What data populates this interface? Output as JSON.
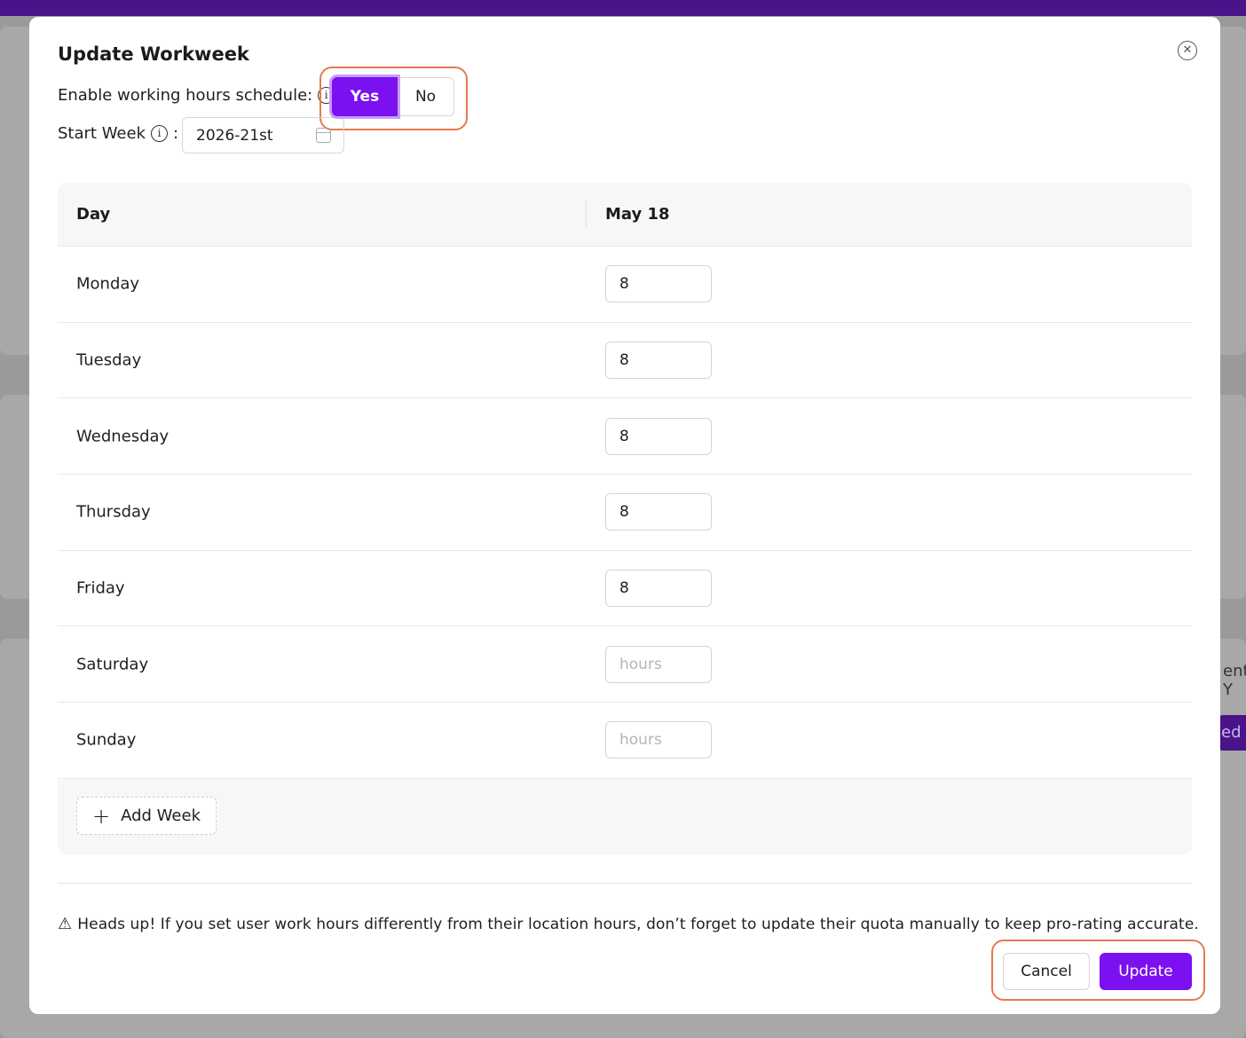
{
  "modal": {
    "title": "Update Workweek",
    "close_icon": "close-circle-icon"
  },
  "schedule": {
    "enable_label": "Enable working hours schedule:",
    "yes_label": "Yes",
    "no_label": "No",
    "selected": "Yes"
  },
  "start_week": {
    "label": "Start Week",
    "colon": ":",
    "value": "2026-21st"
  },
  "table": {
    "headers": [
      "Day",
      "May 18"
    ],
    "rows": [
      {
        "day": "Monday",
        "hours": "8"
      },
      {
        "day": "Tuesday",
        "hours": "8"
      },
      {
        "day": "Wednesday",
        "hours": "8"
      },
      {
        "day": "Thursday",
        "hours": "8"
      },
      {
        "day": "Friday",
        "hours": "8"
      },
      {
        "day": "Saturday",
        "hours": ""
      },
      {
        "day": "Sunday",
        "hours": ""
      }
    ],
    "hours_placeholder": "hours",
    "add_week_label": "Add Week"
  },
  "warning": {
    "text": "Heads up! If you set user work hours differently from their location hours, don’t forget to update their quota manually to keep pro-rating accurate."
  },
  "footer": {
    "cancel_label": "Cancel",
    "update_label": "Update"
  },
  "background": {
    "partial_text_1": "ent Y",
    "partial_text_2": "ed (I"
  },
  "colors": {
    "accent": "#7b10f0",
    "highlight_outline": "#e87a4e",
    "top_bar": "#4a138a"
  }
}
